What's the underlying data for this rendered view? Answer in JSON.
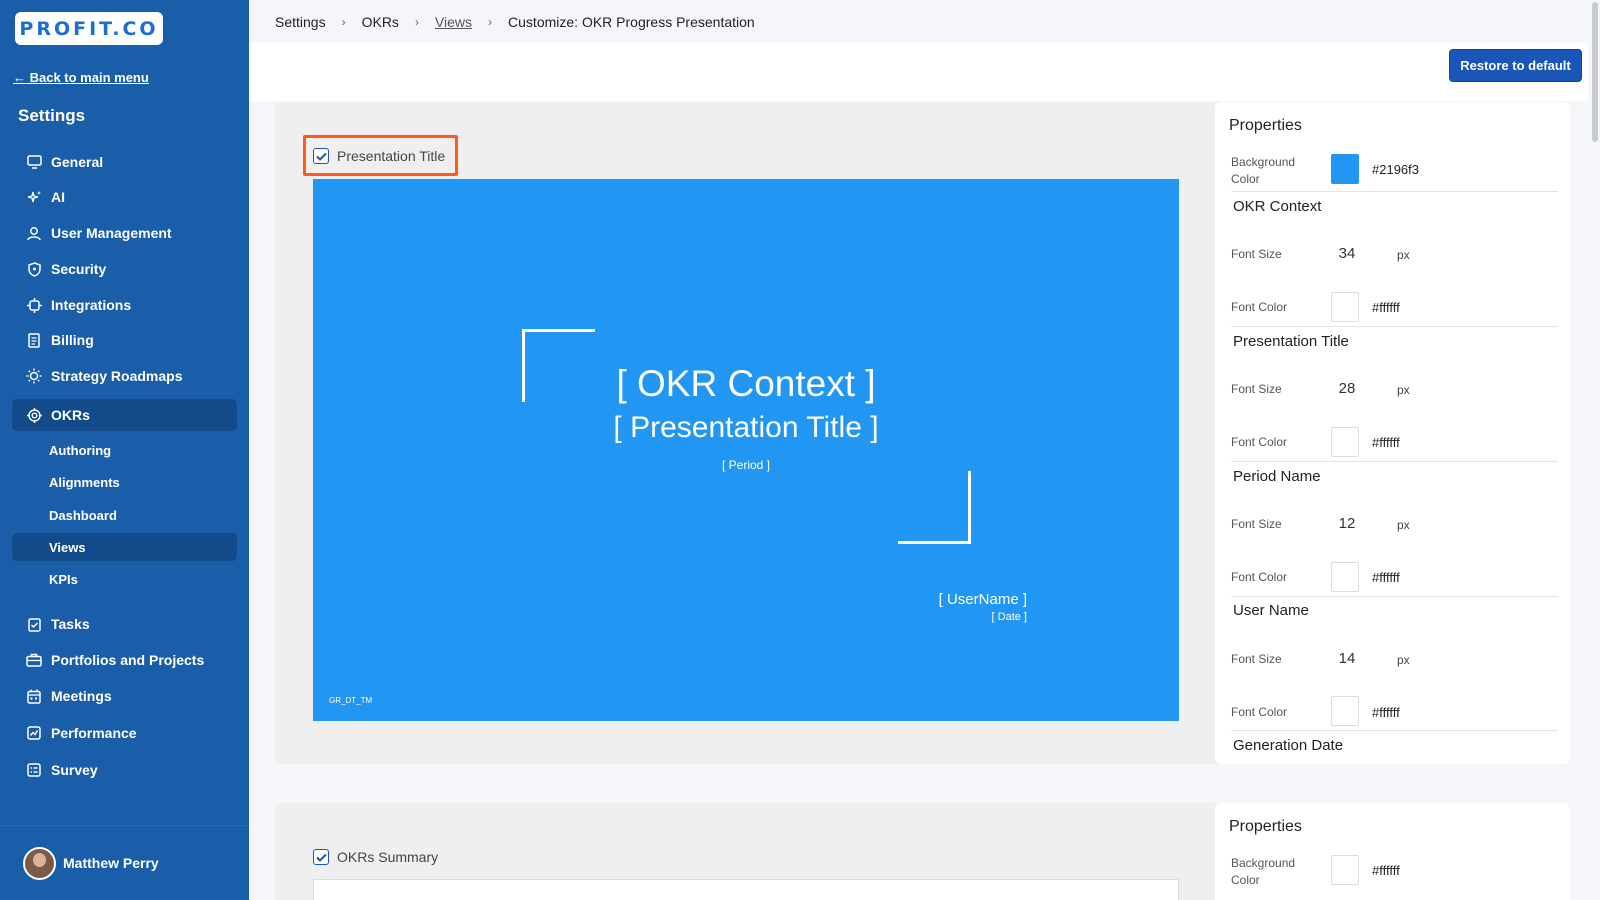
{
  "brand": {
    "logo_text": "PROFIT.CO"
  },
  "sidebar": {
    "back_label": "← Back to main menu",
    "heading": "Settings",
    "items": [
      {
        "label": "General",
        "icon": "monitor-icon"
      },
      {
        "label": "AI",
        "icon": "sparkle-icon"
      },
      {
        "label": "User Management",
        "icon": "user-icon"
      },
      {
        "label": "Security",
        "icon": "shield-icon"
      },
      {
        "label": "Integrations",
        "icon": "plug-icon"
      },
      {
        "label": "Billing",
        "icon": "receipt-icon"
      },
      {
        "label": "Strategy Roadmaps",
        "icon": "bulb-icon"
      },
      {
        "label": "OKRs",
        "icon": "target-icon"
      }
    ],
    "okr_subitems": [
      {
        "label": "Authoring"
      },
      {
        "label": "Alignments"
      },
      {
        "label": "Dashboard"
      },
      {
        "label": "Views"
      },
      {
        "label": "KPIs"
      }
    ],
    "items_after": [
      {
        "label": "Tasks",
        "icon": "checklist-icon"
      },
      {
        "label": "Portfolios and Projects",
        "icon": "briefcase-icon"
      },
      {
        "label": "Meetings",
        "icon": "calendar-icon"
      },
      {
        "label": "Performance",
        "icon": "chart-icon"
      },
      {
        "label": "Survey",
        "icon": "survey-icon"
      }
    ],
    "user": {
      "name": "Matthew Perry"
    }
  },
  "breadcrumb": {
    "items": [
      "Settings",
      "OKRs",
      "Views",
      "Customize: OKR Progress Presentation"
    ]
  },
  "actions": {
    "restore_label": "Restore to default"
  },
  "section1": {
    "checkbox_label": "Presentation Title",
    "slide": {
      "background": "#2196f3",
      "context": "[ OKR Context ]",
      "title": "[ Presentation Title ]",
      "period": "[ Period ]",
      "user": "[ UserName ]",
      "date": "[ Date ]",
      "footer": "GR_DT_TM"
    },
    "properties": {
      "heading": "Properties",
      "background_label": "Background Color",
      "background_value": "#2196f3",
      "groups": [
        {
          "title": "OKR Context",
          "font_size_label": "Font Size",
          "font_size": "34",
          "unit": "px",
          "font_color_label": "Font Color",
          "font_color": "#ffffff"
        },
        {
          "title": "Presentation Title",
          "font_size_label": "Font Size",
          "font_size": "28",
          "unit": "px",
          "font_color_label": "Font Color",
          "font_color": "#ffffff"
        },
        {
          "title": "Period Name",
          "font_size_label": "Font Size",
          "font_size": "12",
          "unit": "px",
          "font_color_label": "Font Color",
          "font_color": "#ffffff"
        },
        {
          "title": "User Name",
          "font_size_label": "Font Size",
          "font_size": "14",
          "unit": "px",
          "font_color_label": "Font Color",
          "font_color": "#ffffff"
        }
      ],
      "last_group_title": "Generation Date"
    }
  },
  "section2": {
    "checkbox_label": "OKRs Summary",
    "properties": {
      "heading": "Properties",
      "background_label": "Background Color",
      "background_value": "#ffffff"
    }
  }
}
